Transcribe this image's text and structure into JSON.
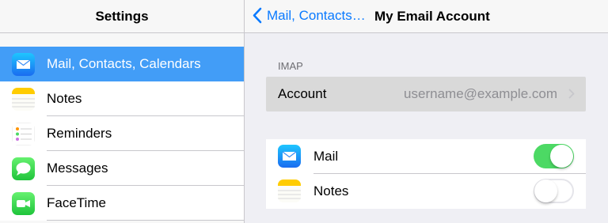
{
  "sidebar": {
    "title": "Settings",
    "items": [
      {
        "label": "Mail, Contacts, Calendars",
        "icon": "mail-icon",
        "selected": true
      },
      {
        "label": "Notes",
        "icon": "notes-icon"
      },
      {
        "label": "Reminders",
        "icon": "reminders-icon"
      },
      {
        "label": "Messages",
        "icon": "messages-icon"
      },
      {
        "label": "FaceTime",
        "icon": "facetime-icon"
      }
    ]
  },
  "detail": {
    "back_label": "Mail, Contacts…",
    "title": "My Email Account",
    "section_label": "IMAP",
    "account": {
      "label": "Account",
      "value": "username@example.com"
    },
    "toggles": [
      {
        "label": "Mail",
        "icon": "mail-icon",
        "on": true
      },
      {
        "label": "Notes",
        "icon": "notes-icon",
        "on": false
      }
    ]
  },
  "colors": {
    "accent": "#0a7aff",
    "selected_row": "#429df7",
    "toggle_on": "#4cd964"
  }
}
